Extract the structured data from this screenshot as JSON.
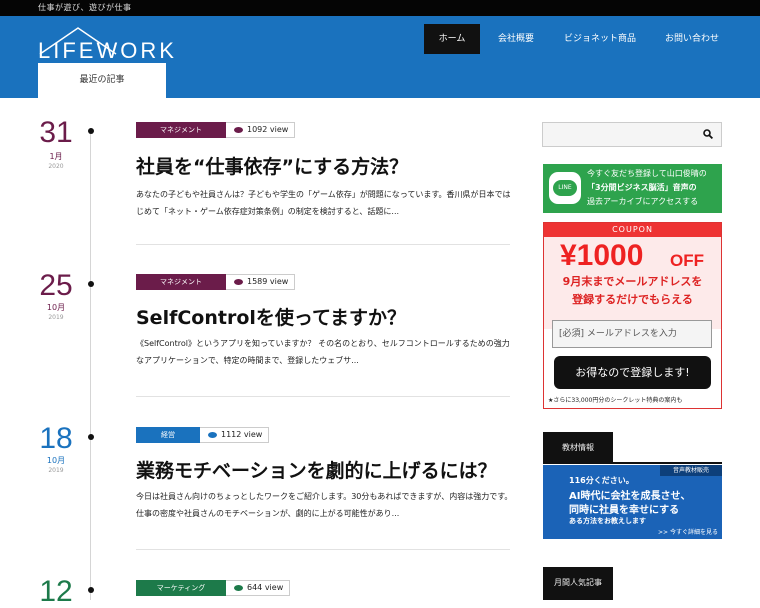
{
  "topbar": {
    "text": "仕事が遊び、遊びが仕事"
  },
  "logo": {
    "text": "LIFEWORK"
  },
  "nav": {
    "items": [
      {
        "label": "ホーム"
      },
      {
        "label": "会社概要"
      },
      {
        "label": "ビジョネット商品"
      },
      {
        "label": "お問い合わせ"
      }
    ]
  },
  "tab": {
    "label": "最近の記事"
  },
  "posts": [
    {
      "day": "31",
      "month": "1月",
      "year": "2020",
      "color": "#6b1c4a",
      "category": "マネジメント",
      "cat_color": "#6b1c4a",
      "views": "1092 view",
      "title": "社員を“仕事依存”にする方法？",
      "excerpt": "あなたの子どもや社員さんは？子どもや学生の「ゲーム依存」が問題になっています。香川県が日本ではじめて「ネット・ゲーム依存症対策条例」の制定を検討すると、話題に..."
    },
    {
      "day": "25",
      "month": "10月",
      "year": "2019",
      "color": "#6b1c4a",
      "category": "マネジメント",
      "cat_color": "#6b1c4a",
      "views": "1589 view",
      "title": "SelfControlを使ってますか？",
      "excerpt": "《SelfControl》というアプリを知っていますか？ その名のとおり、セルフコントロールするための強力なアプリケーションで、特定の時間まで、登録したウェブサ..."
    },
    {
      "day": "18",
      "month": "10月",
      "year": "2019",
      "color": "#1a72be",
      "category": "経営",
      "cat_color": "#1a72be",
      "views": "1112 view",
      "title": "業務モチベーションを劇的に上げるには？",
      "excerpt": "今日は社員さん向けのちょっとしたワークをご紹介します。30分もあればできますが、内容は強力です。仕事の密度や社員さんのモチベーションが、劇的に上がる可能性があり..."
    },
    {
      "day": "12",
      "month": "",
      "year": "",
      "color": "#1d7a4a",
      "category": "マーケティング",
      "cat_color": "#1d7a4a",
      "views": "644 view",
      "title": "",
      "excerpt": ""
    }
  ],
  "sidebar": {
    "line_banner": {
      "badge": "LINE",
      "line1": "今すぐ友だち登録して山口俊晴の",
      "line2": "「3分間ビジネス脳活」音声の",
      "line3": "過去アーカイブにアクセスする"
    },
    "coupon": {
      "header": "COUPON",
      "amount": "¥1000",
      "off": "OFF",
      "line1": "9月末までメールアドレスを",
      "line2": "登録するだけでもらえる",
      "email_placeholder": "[必須] メールアドレスを入力",
      "submit": "お得なので登録します!",
      "footnote": "★さらに33,000円分のシークレット特典の案内も"
    },
    "widget1": {
      "title": "教材情報"
    },
    "teacher": {
      "tag": "音声教材販売",
      "l1": "116分ください。",
      "l2": "AI時代に会社を成長させ、",
      "l3": "同時に社員を幸せにする",
      "l4": "ある方法をお教えします",
      "cta": ">> 今すぐ詳細を見る"
    },
    "widget2": {
      "title": "月間人気記事"
    }
  }
}
